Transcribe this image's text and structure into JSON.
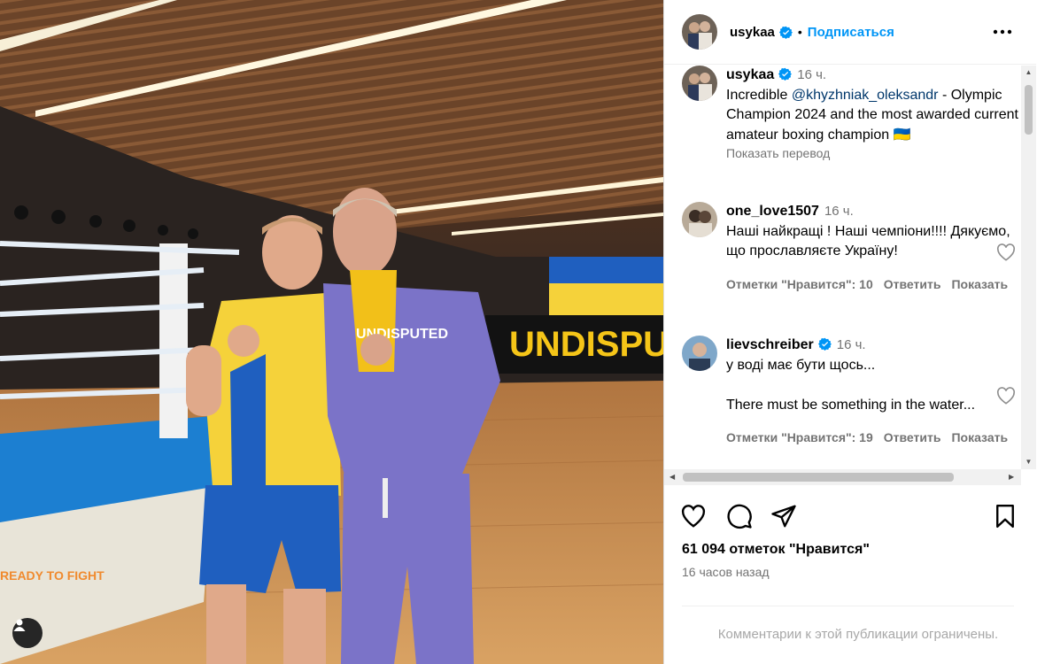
{
  "post": {
    "author": "usykaa",
    "follow_label": "Подписаться",
    "dot": "•"
  },
  "comments": [
    {
      "username": "usykaa",
      "verified": true,
      "time": "16 ч.",
      "text_before": "Incredible ",
      "mention": "@khyzhniak_oleksandr",
      "text_after": " - Olympic Champion 2024 and the most awarded current amateur boxing champion 🇺🇦",
      "translate": "Показать перевод"
    },
    {
      "username": "one_love1507",
      "time": "16 ч.",
      "text": "Наші найкращі ! Наші чемпіони!!!! Дякуємо, що прославляєте Україну!",
      "likes": "Отметки \"Нравится\": 10",
      "reply": "Ответить",
      "show": "Показать"
    },
    {
      "username": "lievschreiber",
      "verified": true,
      "time": "16 ч.",
      "text_line1": "у воді має бути щось...",
      "text_line2": "There must be something in the water...",
      "likes": "Отметки \"Нравится\": 19",
      "reply": "Ответить",
      "show": "Показать"
    }
  ],
  "actions": {
    "likes_count": "61 094 отметок \"Нравится\"",
    "time_ago": "16 часов назад",
    "comments_restricted": "Комментарии к этой публикации ограничены."
  },
  "photo_text": {
    "banner": "UNDISPU",
    "shirt": "UNDISPUTED",
    "ring_pad": "READY TO FIGHT"
  },
  "colors": {
    "accent": "#0095f6",
    "ukraine_blue": "#1f5fbf",
    "ukraine_yellow": "#f5d23a",
    "hoodie": "#7b73c8"
  }
}
